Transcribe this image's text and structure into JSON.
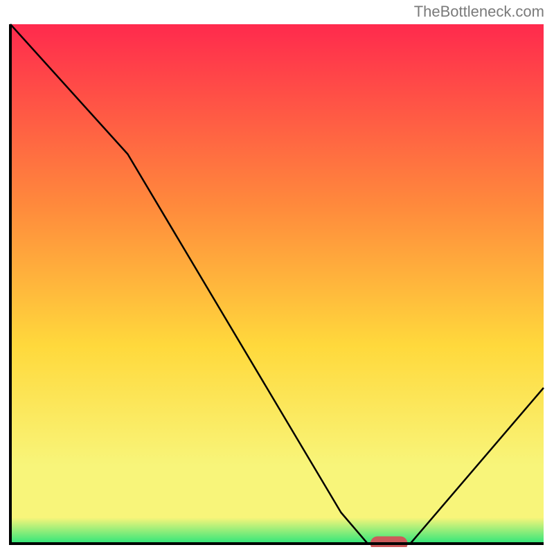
{
  "watermark": "TheBottleneck.com",
  "chart_data": {
    "type": "line",
    "title": "",
    "xlabel": "",
    "ylabel": "",
    "xlim": [
      0,
      100
    ],
    "ylim": [
      0,
      100
    ],
    "grid": false,
    "gradient_colors": {
      "top": "#ff2a4d",
      "upper_mid": "#ff8a3c",
      "mid": "#ffd93c",
      "lower_mid": "#f8f57a",
      "bottom": "#2ee67a"
    },
    "curve": [
      {
        "x": 0,
        "y": 100
      },
      {
        "x": 22,
        "y": 75
      },
      {
        "x": 62,
        "y": 6
      },
      {
        "x": 67,
        "y": 0
      },
      {
        "x": 75,
        "y": 0
      },
      {
        "x": 100,
        "y": 30
      }
    ],
    "marker": {
      "x": 71,
      "y": 0,
      "color": "#cc5a5a",
      "width": 7,
      "height": 2.8
    }
  }
}
